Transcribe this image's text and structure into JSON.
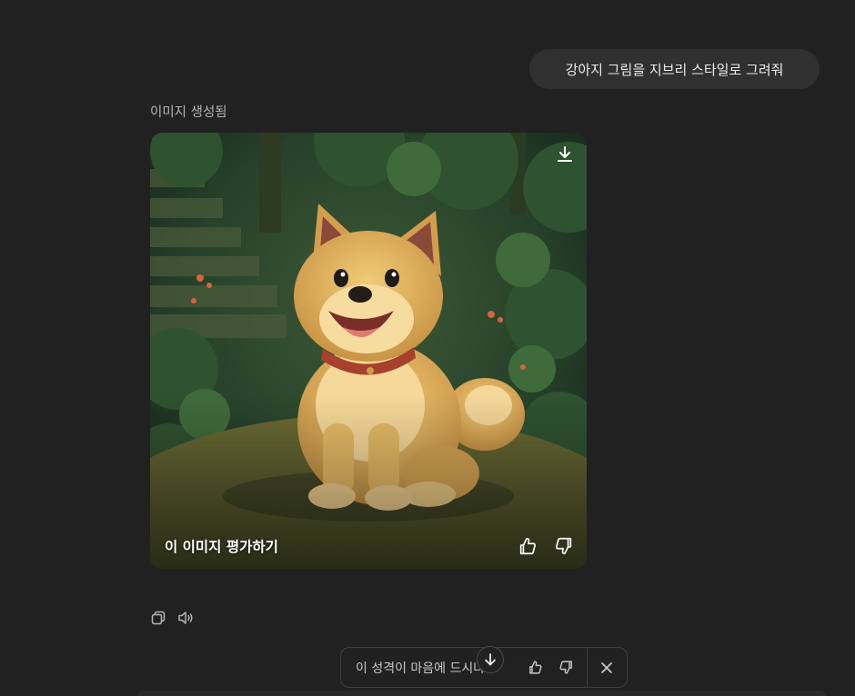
{
  "user_message": "강아지 그림을 지브리 스타일로 그려줘",
  "assistant": {
    "status_label": "이미지 생성됨",
    "image": {
      "rate_label": "이 이미지 평가하기"
    }
  },
  "feedback": {
    "prompt": "이 성격이 마음에 드시나요"
  },
  "icons": {
    "download": "download-icon",
    "thumbs_up": "thumbs-up-icon",
    "thumbs_down": "thumbs-down-icon",
    "copy": "copy-icon",
    "speaker": "speaker-icon",
    "close": "close-icon",
    "arrow_down": "arrow-down-icon"
  },
  "colors": {
    "background": "#212121",
    "bubble": "#303030",
    "dog_fur": "#e3b45a",
    "collar": "#a8402e"
  }
}
